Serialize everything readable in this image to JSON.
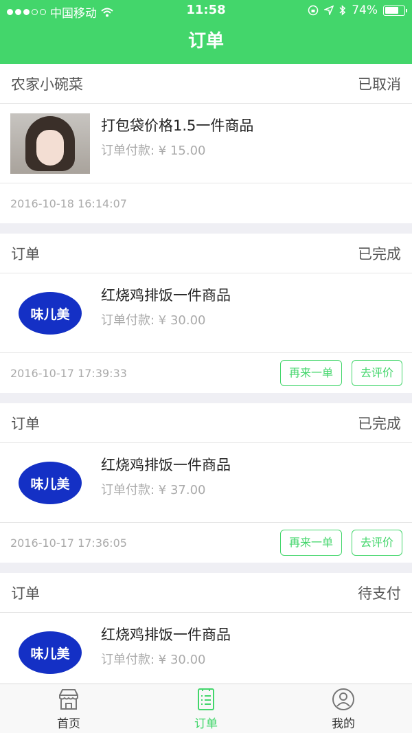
{
  "status_bar": {
    "carrier": "中国移动",
    "time": "11:58",
    "battery": "74%",
    "battery_level": 0.74
  },
  "nav": {
    "title": "订单"
  },
  "orders": [
    {
      "shop": "农家小碗菜",
      "status": "已取消",
      "thumb": "portrait-photo",
      "product": "打包袋价格1.5一件商品",
      "price": "订单付款: ¥ 15.00",
      "time": "2016-10-18 16:14:07",
      "actions": []
    },
    {
      "shop": "订单",
      "status": "已完成",
      "thumb_text": "味儿美",
      "product": "红烧鸡排饭一件商品",
      "price": "订单付款: ¥ 30.00",
      "time": "2016-10-17 17:39:33",
      "actions": [
        "再来一单",
        "去评价"
      ]
    },
    {
      "shop": "订单",
      "status": "已完成",
      "thumb_text": "味儿美",
      "product": "红烧鸡排饭一件商品",
      "price": "订单付款: ¥ 37.00",
      "time": "2016-10-17 17:36:05",
      "actions": [
        "再来一单",
        "去评价"
      ]
    },
    {
      "shop": "订单",
      "status": "待支付",
      "thumb_text": "味儿美",
      "product": "红烧鸡排饭一件商品",
      "price": "订单付款: ¥ 30.00"
    }
  ],
  "tabs": [
    {
      "label": "首页",
      "icon": "store-icon"
    },
    {
      "label": "订单",
      "icon": "list-icon"
    },
    {
      "label": "我的",
      "icon": "user-icon"
    }
  ],
  "colors": {
    "accent": "#43d66b",
    "logo": "#1430c5"
  }
}
